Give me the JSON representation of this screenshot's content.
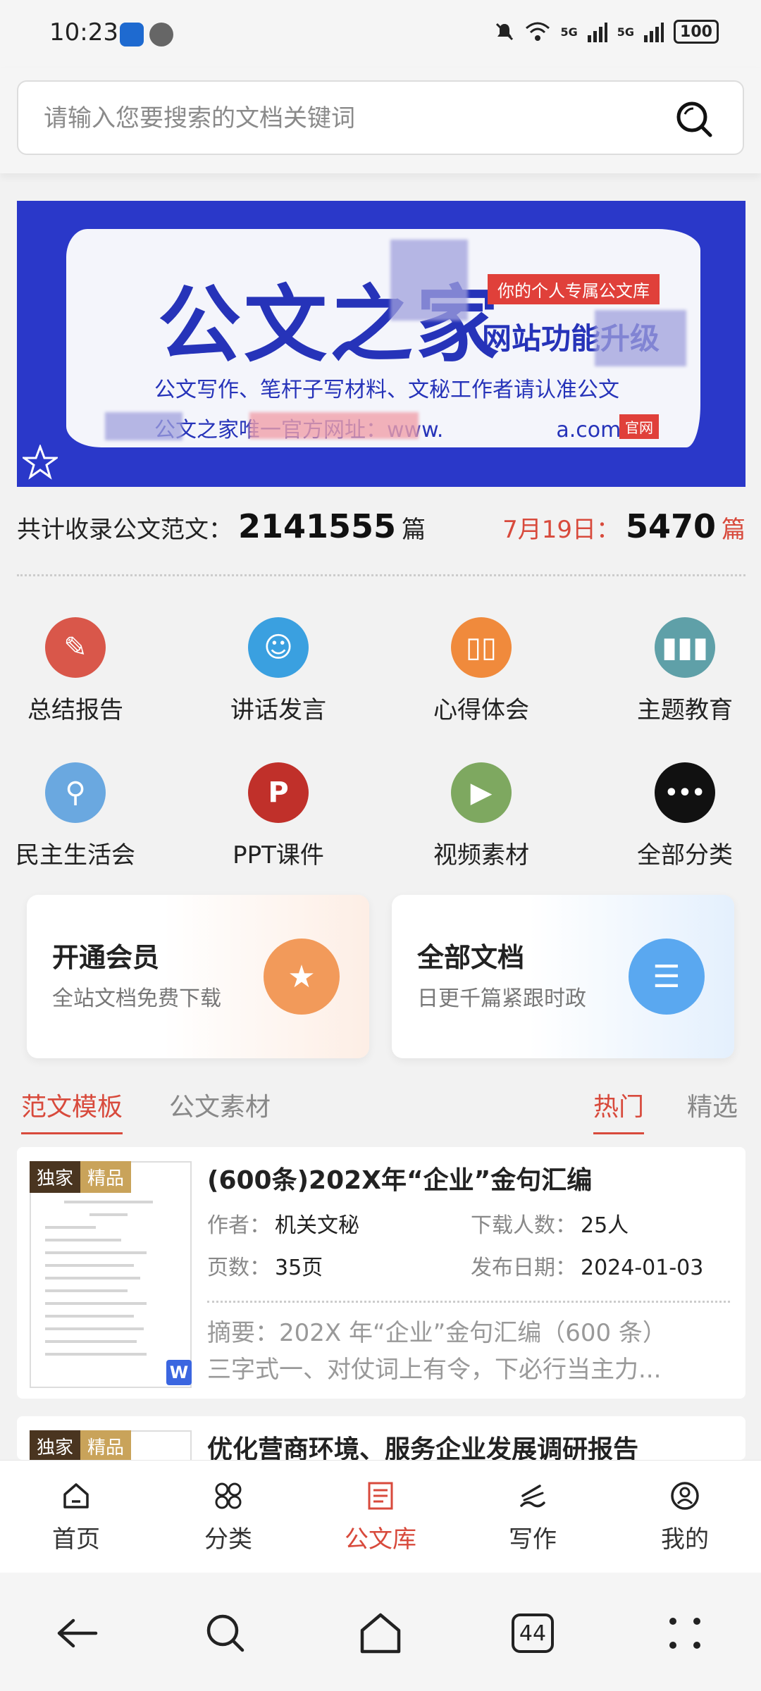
{
  "status_bar": {
    "time": "10:23",
    "signal1": "5G",
    "signal2": "5G",
    "battery": "100"
  },
  "search": {
    "placeholder": "请输入您要搜索的文档关键词"
  },
  "banner": {
    "title": "公文之家",
    "tag": "你的个人专属公文库",
    "subtitle": "网站功能升级",
    "line1": "公文写作、笔杆子写材料、文秘工作者请认准公文",
    "line2": "公文之家唯一官方网址：www.",
    "line2_end": "a.com",
    "badge": "官网"
  },
  "stats": {
    "total_label": "共计收录公文范文：",
    "total_value": "2141555",
    "total_unit": "篇",
    "today_label": "7月19日：",
    "today_value": "5470",
    "today_unit": "篇"
  },
  "categories": [
    {
      "label": "总结报告",
      "icon": "pen-book-icon",
      "color": "#d9574a"
    },
    {
      "label": "讲话发言",
      "icon": "speaker-icon",
      "color": "#3aa0e0"
    },
    {
      "label": "心得体会",
      "icon": "open-book-icon",
      "color": "#f08a3c"
    },
    {
      "label": "主题教育",
      "icon": "binders-icon",
      "color": "#5fa0a8"
    },
    {
      "label": "民主生活会",
      "icon": "lamp-icon",
      "color": "#6aa8e0"
    },
    {
      "label": "PPT课件",
      "icon": "ppt-icon",
      "color": "#c0302a"
    },
    {
      "label": "视频素材",
      "icon": "video-camera-icon",
      "color": "#7ea860"
    },
    {
      "label": "全部分类",
      "icon": "more-dots-icon",
      "color": "#111111"
    }
  ],
  "cards": {
    "member": {
      "title": "开通会员",
      "subtitle": "全站文档免费下载",
      "icon": "trophy-icon"
    },
    "docs": {
      "title": "全部文档",
      "subtitle": "日更千篇紧跟时政",
      "icon": "document-list-icon"
    }
  },
  "tabs": {
    "templates": "范文模板",
    "materials": "公文素材",
    "hot": "热门",
    "selected": "精选"
  },
  "documents": [
    {
      "badge1": "独家",
      "badge2": "精品",
      "title": "(600条)202X年“企业”金句汇编",
      "author_label": "作者：",
      "author": "机关文秘",
      "downloads_label": "下载人数：",
      "downloads": "25人",
      "pages_label": "页数：",
      "pages": "35页",
      "date_label": "发布日期：",
      "date": "2024-01-03",
      "abstract1": "摘要：202X 年“企业”金句汇编（600 条）",
      "abstract2": "三字式一、对仗词上有令，下必行当主力..."
    },
    {
      "badge1": "独家",
      "badge2": "精品",
      "title": "优化营商环境、服务企业发展调研报告"
    }
  ],
  "bottom_nav": [
    {
      "label": "首页",
      "icon": "home-icon"
    },
    {
      "label": "分类",
      "icon": "grid-icon"
    },
    {
      "label": "公文库",
      "icon": "document-icon"
    },
    {
      "label": "写作",
      "icon": "writing-icon"
    },
    {
      "label": "我的",
      "icon": "profile-icon"
    }
  ],
  "system_nav": {
    "tab_count": "44"
  }
}
